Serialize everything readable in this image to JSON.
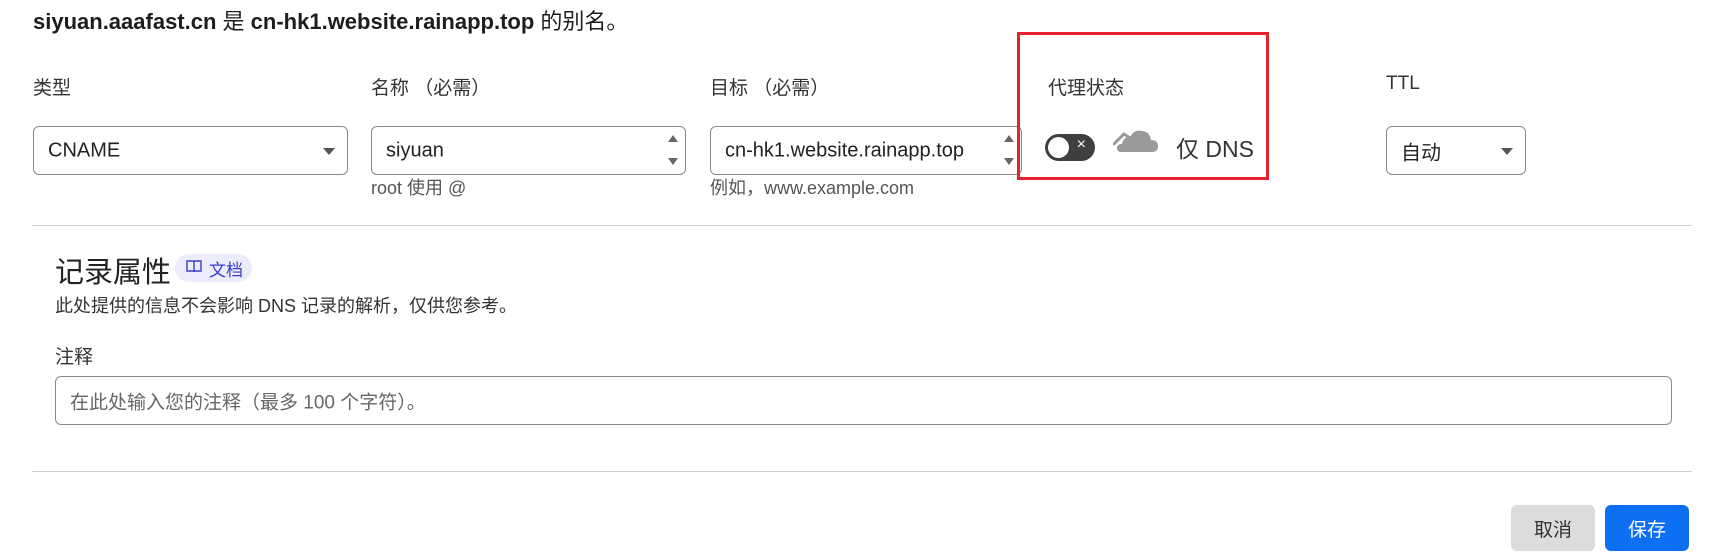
{
  "summary": {
    "name": "siyuan.aaafast.cn",
    "is_word": " 是 ",
    "target": "cn-hk1.website.rainapp.top",
    "suffix": " 的别名。"
  },
  "form": {
    "type": {
      "label": "类型",
      "value": "CNAME"
    },
    "name": {
      "label": "名称 （必需）",
      "value": "siyuan",
      "hint": "root 使用 @"
    },
    "target": {
      "label": "目标 （必需）",
      "value": "cn-hk1.website.rainapp.top",
      "hint": "例如，www.example.com"
    },
    "proxy": {
      "label": "代理状态",
      "enabled": false,
      "status_text": "仅 DNS",
      "toggle_x": "×"
    },
    "ttl": {
      "label": "TTL",
      "value": "自动"
    }
  },
  "record_attributes": {
    "title": "记录属性",
    "doc_badge": "文档",
    "description": "此处提供的信息不会影响 DNS 记录的解析，仅供您参考。",
    "comment_label": "注释",
    "comment_placeholder": "在此处输入您的注释（最多 100 个字符）。",
    "comment_value": ""
  },
  "actions": {
    "cancel": "取消",
    "save": "保存"
  },
  "colors": {
    "highlight_box": "#e3232e",
    "primary": "#0d6ff4",
    "badge_bg": "#ececfd",
    "badge_text": "#3b3fc6",
    "cloud": "#9a9a9a"
  },
  "icons": [
    "chevron-down-icon",
    "spinner-arrows-icon",
    "toggle-off-icon",
    "close-icon",
    "cloud-dns-only-icon",
    "book-icon"
  ]
}
